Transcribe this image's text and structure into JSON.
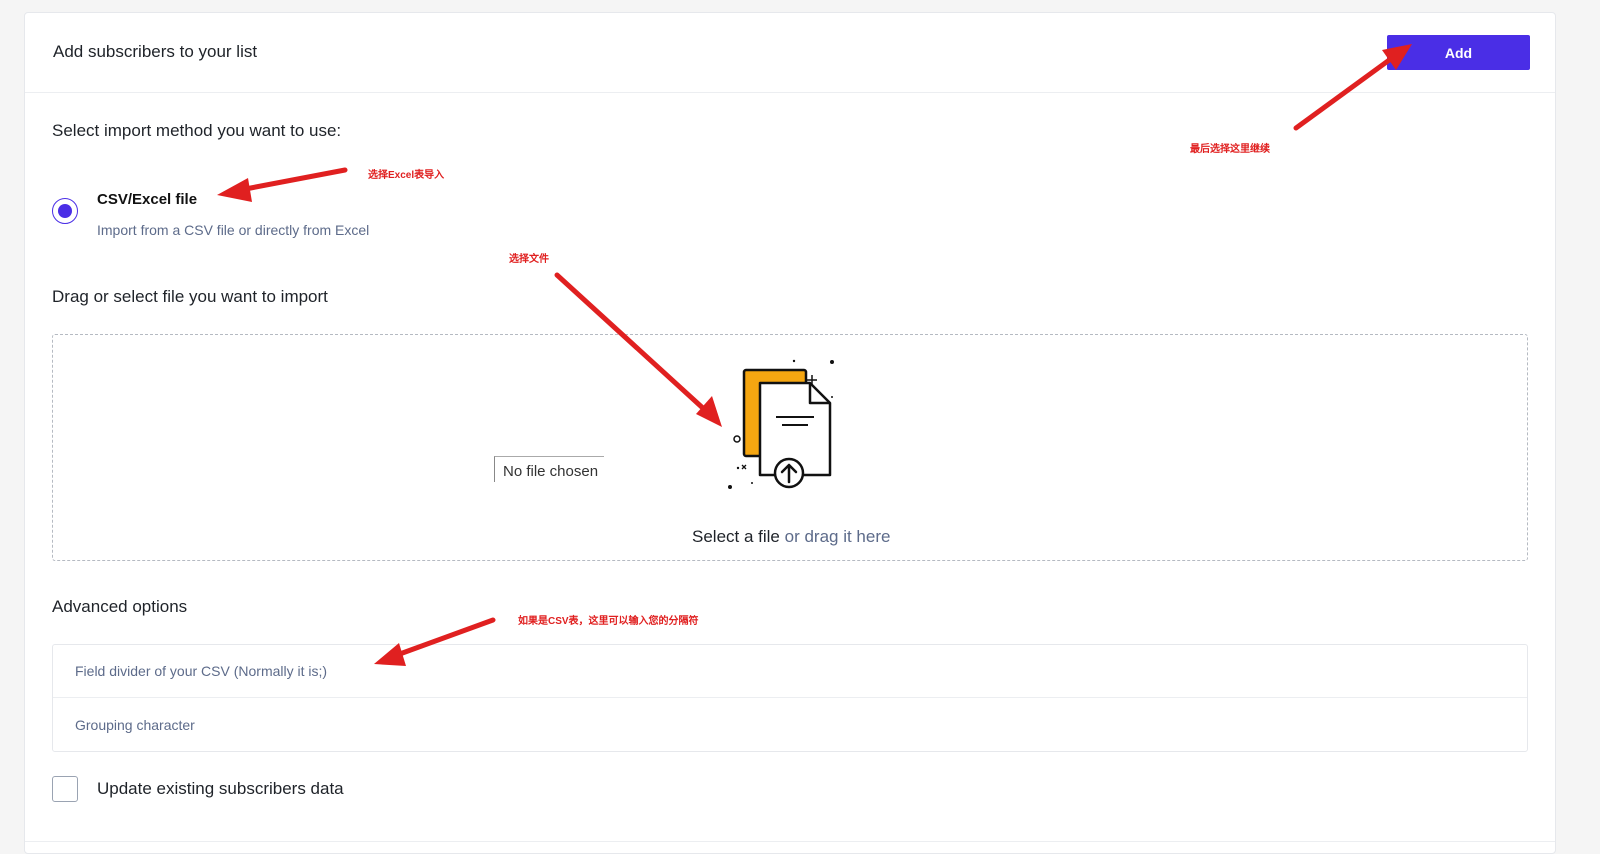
{
  "header": {
    "title": "Add subscribers to your list",
    "add_label": "Add"
  },
  "import": {
    "method_prompt": "Select import method you want to use:",
    "method_title": "CSV/Excel file",
    "method_desc": "Import from a CSV file or directly from Excel",
    "method_selected": true
  },
  "file": {
    "section_label": "Drag or select file you want to import",
    "input_status": "No file chosen",
    "select_text": "Select a file",
    "drag_text": " or drag it here"
  },
  "advanced": {
    "label": "Advanced options",
    "field_divider_placeholder": "Field divider of your CSV (Normally it is;)",
    "grouping_placeholder": "Grouping character"
  },
  "update": {
    "label": "Update existing subscribers data",
    "checked": false
  },
  "annotations": {
    "excel": "选择Excel表导入",
    "file": "选择文件",
    "continue": "最后选择这里继续",
    "csv": "如果是CSV表，这里可以输入您的分隔符"
  },
  "colors": {
    "accent": "#4a2ee6",
    "annotation": "#e02020",
    "folder": "#f5a611",
    "muted_text": "#5d6b8a"
  },
  "icons": {
    "upload": "file-upload-illustration"
  }
}
